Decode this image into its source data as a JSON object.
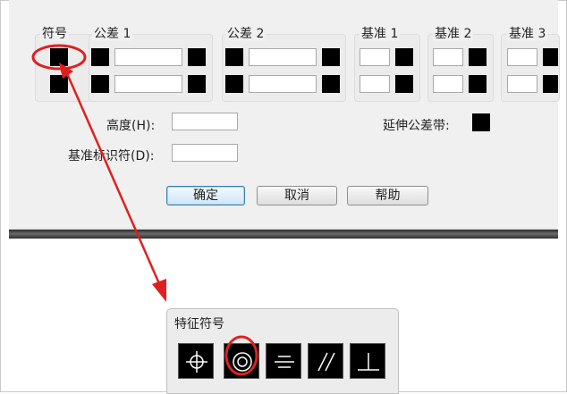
{
  "dialog": {
    "columns": {
      "symbol": "符号",
      "tol1": "公差 1",
      "tol2": "公差 2",
      "datum1": "基准 1",
      "datum2": "基准 2",
      "datum3": "基准 3"
    },
    "height_label": "高度(H):",
    "datum_id_label": "基准标识符(D):",
    "projected_zone_label": "延伸公差带:",
    "buttons": {
      "ok": "确定",
      "cancel": "取消",
      "help": "帮助"
    }
  },
  "popup": {
    "title": "特征符号",
    "symbols": [
      "position-icon",
      "concentricity-icon",
      "symmetry-icon",
      "parallelism-icon",
      "perpendicularity-icon"
    ]
  },
  "annotation": {
    "color": "#e02020"
  }
}
